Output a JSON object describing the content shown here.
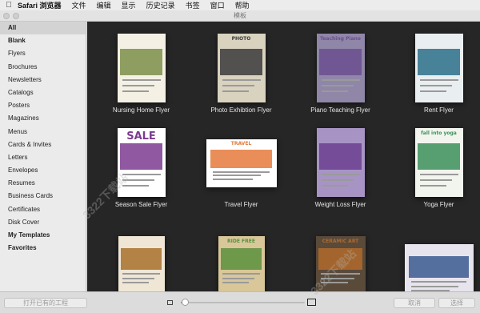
{
  "menubar": {
    "apple_icon": "apple-logo-icon",
    "app_name": "Safari 浏览器",
    "items": [
      "文件",
      "编辑",
      "显示",
      "历史记录",
      "书签",
      "窗口",
      "帮助"
    ]
  },
  "window": {
    "title": "模板"
  },
  "sidebar": {
    "items": [
      {
        "label": "All",
        "style": "selected"
      },
      {
        "label": "Blank",
        "style": "bold"
      },
      {
        "label": "Flyers",
        "style": ""
      },
      {
        "label": "Brochures",
        "style": ""
      },
      {
        "label": "Newsletters",
        "style": ""
      },
      {
        "label": "Catalogs",
        "style": ""
      },
      {
        "label": "Posters",
        "style": ""
      },
      {
        "label": "Magazines",
        "style": ""
      },
      {
        "label": "Menus",
        "style": ""
      },
      {
        "label": "Cards & Invites",
        "style": ""
      },
      {
        "label": "Letters",
        "style": ""
      },
      {
        "label": "Envelopes",
        "style": ""
      },
      {
        "label": "Resumes",
        "style": ""
      },
      {
        "label": "Business Cards",
        "style": ""
      },
      {
        "label": "Certificates",
        "style": ""
      },
      {
        "label": "Disk Cover",
        "style": ""
      },
      {
        "label": "My Templates",
        "style": "bold"
      },
      {
        "label": "Favorites",
        "style": "bold"
      }
    ]
  },
  "templates": [
    {
      "caption": "Nursing Home Flyer",
      "heading": "",
      "accent": "#7b8f4a",
      "bg": "#f4f1e4"
    },
    {
      "caption": "Photo Exhibtion Flyer",
      "heading": "PHOTO",
      "accent": "#3b3b3b",
      "bg": "#d9d2bf"
    },
    {
      "caption": "Piano Teaching Flyer",
      "heading": "Teaching Piano",
      "accent": "#6b4f8f",
      "bg": "#8f86a8"
    },
    {
      "caption": "Rent Flyer",
      "heading": "",
      "accent": "#2c6f8a",
      "bg": "#e9eef0"
    },
    {
      "caption": "Season Sale Flyer",
      "heading": "SALE",
      "accent": "#7b3b8f",
      "bg": "#ffffff"
    },
    {
      "caption": "Travel Flyer",
      "heading": "TRAVEL",
      "accent": "#e57a3c",
      "bg": "#ffffff"
    },
    {
      "caption": "Weight Loss Flyer",
      "heading": "",
      "accent": "#6b3f8f",
      "bg": "#a894c4"
    },
    {
      "caption": "Yoga Flyer",
      "heading": "fall into yoga",
      "accent": "#3c8f5a",
      "bg": "#f1f5ee"
    },
    {
      "caption": "",
      "heading": "",
      "accent": "#a8702c",
      "bg": "#efe6d6"
    },
    {
      "caption": "",
      "heading": "RIDE FREE",
      "accent": "#5a8f3c",
      "bg": "#d9c79a"
    },
    {
      "caption": "",
      "heading": "CERAMIC ART",
      "accent": "#b06a2c",
      "bg": "#5a4a3a"
    },
    {
      "caption": "",
      "heading": "",
      "accent": "#3a5a8f",
      "bg": "#e8e4ee"
    }
  ],
  "bottombar": {
    "open_button": "打开已有的工程",
    "cancel_button": "取消",
    "choose_button": "选择",
    "zoom_fraction": 0.03
  },
  "watermark": "3322下载站"
}
